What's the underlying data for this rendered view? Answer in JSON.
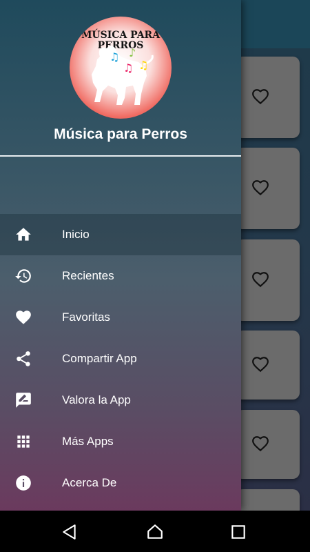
{
  "app": {
    "name": "Música para Perros",
    "logo_text_line1": "MÚSICA PARA",
    "logo_text_line2": "PERROS"
  },
  "menu": {
    "items": [
      {
        "label": "Inicio",
        "icon": "home-icon",
        "active": true
      },
      {
        "label": "Recientes",
        "icon": "history-icon",
        "active": false
      },
      {
        "label": "Favoritas",
        "icon": "heart-icon",
        "active": false
      },
      {
        "label": "Compartir App",
        "icon": "share-icon",
        "active": false
      },
      {
        "label": "Valora la App",
        "icon": "rate-review-icon",
        "active": false
      },
      {
        "label": "Más Apps",
        "icon": "grid-apps-icon",
        "active": false
      },
      {
        "label": "Acerca De",
        "icon": "info-icon",
        "active": false
      }
    ]
  },
  "background_cards": [
    {
      "icon": "heart-outline-icon"
    },
    {
      "icon": "heart-outline-icon"
    },
    {
      "icon": "heart-outline-icon"
    },
    {
      "icon": "heart-outline-icon"
    },
    {
      "icon": "heart-outline-icon"
    }
  ],
  "system_nav": {
    "back": "back-triangle-icon",
    "home": "home-outline-icon",
    "recents": "square-recents-icon"
  },
  "colors": {
    "accent": "#e83a31",
    "drawer_top": "#1f4a5c",
    "drawer_bottom": "#6b3a5e",
    "card": "#6b6b6b"
  }
}
